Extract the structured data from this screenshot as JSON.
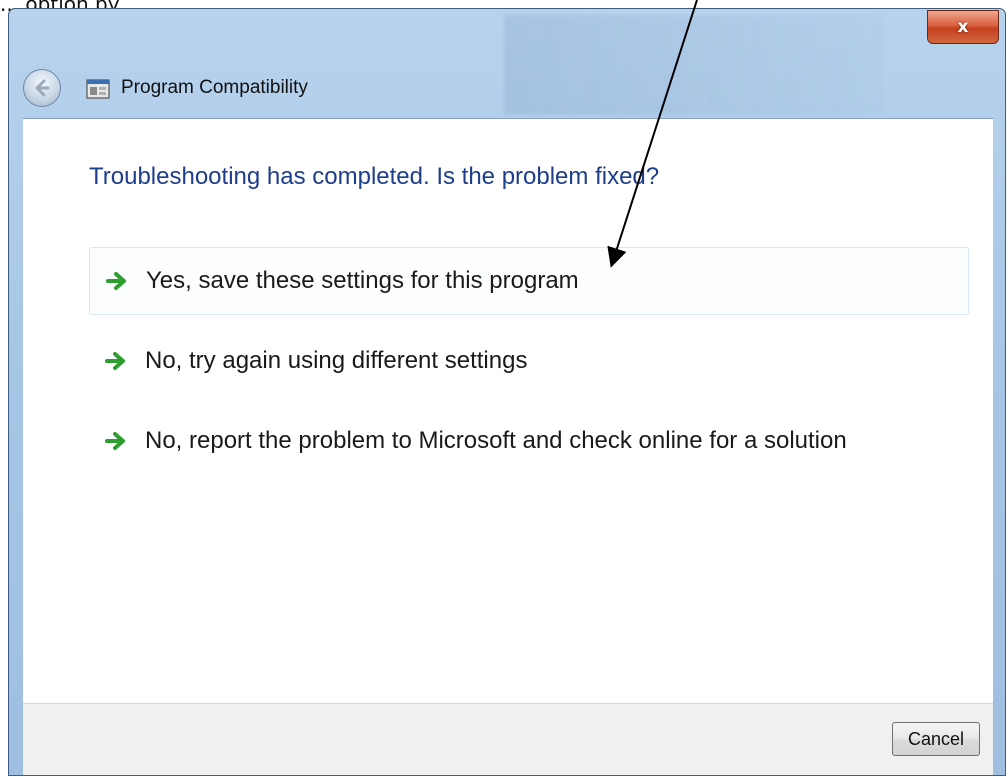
{
  "annotation": {
    "caption_fragment": "... option by . . ."
  },
  "window": {
    "title": "Program Compatibility",
    "close_label": "x",
    "back_icon": "back-arrow-icon",
    "app_icon": "program-compatibility-icon"
  },
  "main": {
    "heading": "Troubleshooting has completed.  Is the problem fixed?",
    "options": [
      {
        "label": "Yes, save these settings for this program",
        "icon": "green-arrow-icon"
      },
      {
        "label": "No, try again using different settings",
        "icon": "green-arrow-icon"
      },
      {
        "label": "No, report the problem to Microsoft and check online for a solution",
        "icon": "green-arrow-icon"
      }
    ]
  },
  "footer": {
    "cancel_label": "Cancel"
  },
  "colors": {
    "heading": "#1e3e8c",
    "close_button": "#c6401f",
    "option_arrow": "#2e9e2e"
  }
}
